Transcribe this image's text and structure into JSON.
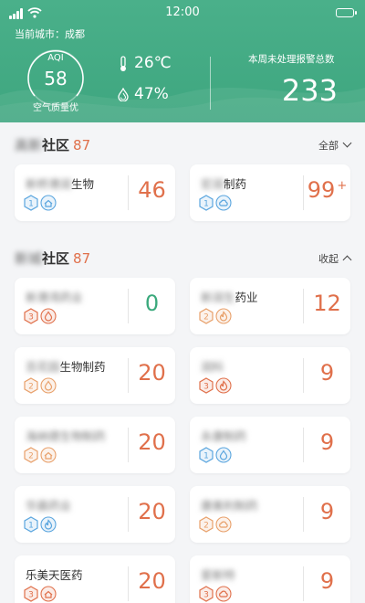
{
  "status": {
    "time": "12:00"
  },
  "header": {
    "city_label": "当前城市：成都",
    "aqi_label": "AQI",
    "aqi_value": "58",
    "aqi_quality": "空气质量优",
    "temperature": "26℃",
    "humidity": "47%",
    "alarm_title": "本周未处理报警总数",
    "alarm_count": "233"
  },
  "colors": {
    "primary": "#3ea67f",
    "accent": "#e0704b",
    "good": "#3aa97c",
    "level1": "#5aa5de",
    "level2": "#e8a06a",
    "level3": "#e0704b"
  },
  "section1": {
    "title_blurred": "高新",
    "title_suffix": "社区",
    "count": "87",
    "toggle_label": "全部",
    "cards": [
      {
        "name_blurred": "新桥港润",
        "name_visible": "生物",
        "level": "1",
        "type_icon": "home-icon",
        "value": "46"
      },
      {
        "name_blurred": "宏润",
        "name_visible": "制药",
        "level": "1",
        "type_icon": "cloud-icon",
        "value": "99",
        "value_suffix": "+"
      }
    ]
  },
  "section2": {
    "title_blurred": "新城",
    "title_suffix": "社区",
    "count": "87",
    "toggle_label": "收起",
    "cards": [
      {
        "name_blurred": "新港湾药业",
        "name_visible": "",
        "level": "3",
        "type_icon": "drop-icon",
        "value": "0"
      },
      {
        "name_blurred": "新润生",
        "name_visible": "药业",
        "level": "2",
        "type_icon": "fire-icon",
        "value": "12"
      },
      {
        "name_blurred": "百花园",
        "name_visible": "生物制药",
        "level": "2",
        "type_icon": "drop-icon",
        "value": "20"
      },
      {
        "name_blurred": "润科",
        "name_visible": "",
        "level": "3",
        "type_icon": "fire-icon",
        "value": "9"
      },
      {
        "name_blurred": "海纳德生物制药",
        "name_visible": "",
        "level": "2",
        "type_icon": "home-icon",
        "value": "20"
      },
      {
        "name_blurred": "永康制药",
        "name_visible": "",
        "level": "1",
        "type_icon": "drop-icon",
        "value": "9"
      },
      {
        "name_blurred": "华晨药业",
        "name_visible": "",
        "level": "1",
        "type_icon": "fire-icon",
        "value": "20"
      },
      {
        "name_blurred": "康美利制药",
        "name_visible": "",
        "level": "2",
        "type_icon": "cloud-icon",
        "value": "9"
      },
      {
        "name_blurred": "",
        "name_visible": "乐美天医药",
        "level": "3",
        "type_icon": "home-icon",
        "value": "20"
      },
      {
        "name_blurred": "爱新特",
        "name_visible": "",
        "level": "3",
        "type_icon": "cloud-icon",
        "value": "9"
      }
    ]
  }
}
